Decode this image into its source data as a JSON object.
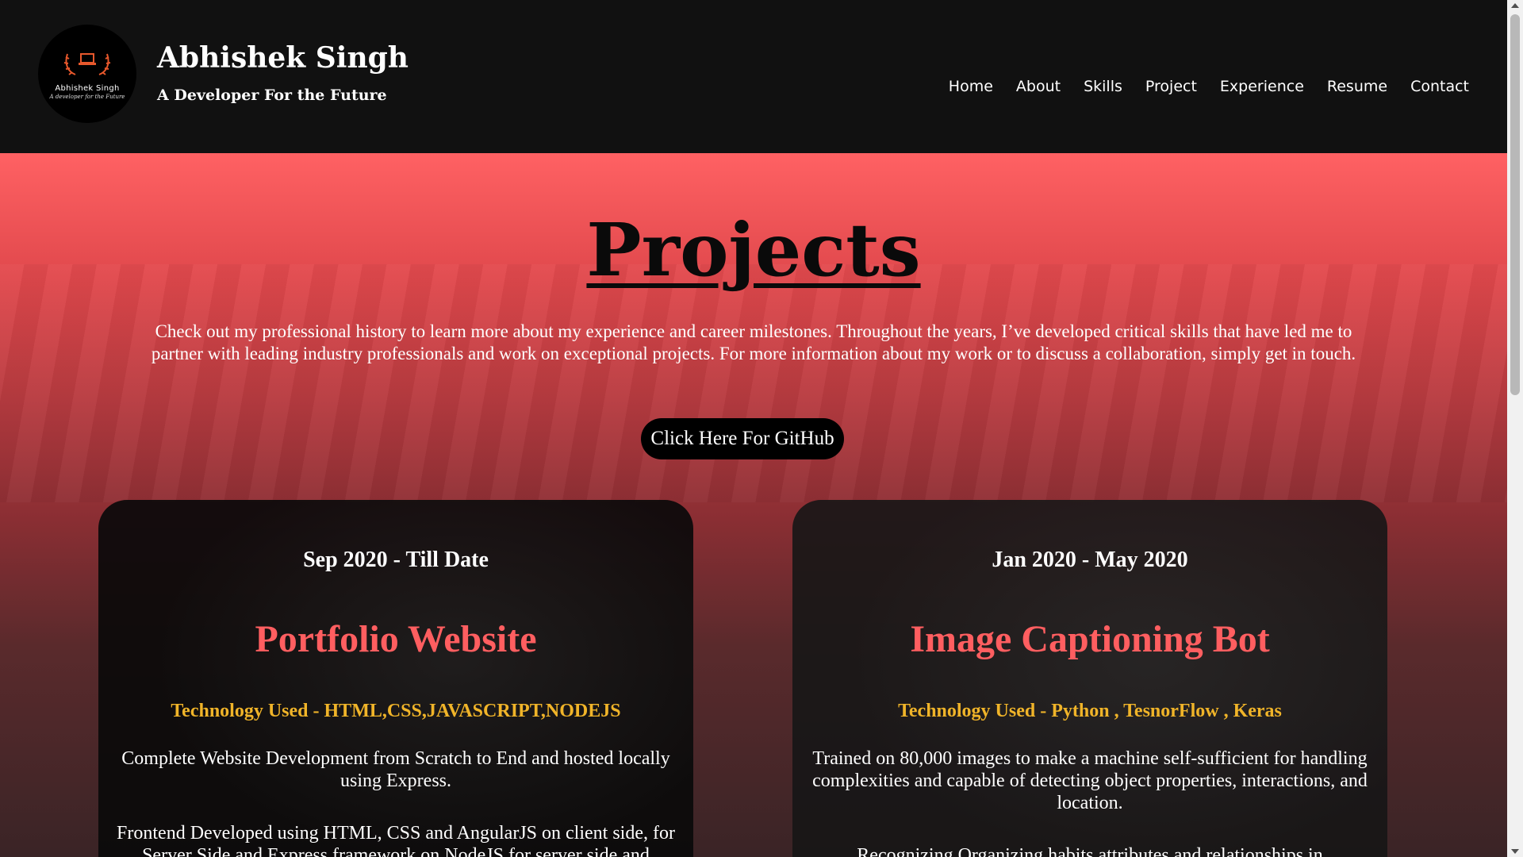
{
  "brand": {
    "logo_name": "Abhishek Singh",
    "logo_tagline": "A developer for the Future",
    "title": "Abhishek Singh",
    "subtitle": "A Developer For the Future"
  },
  "nav": [
    "Home",
    "About",
    "Skills",
    "Project",
    "Experience",
    "Resume",
    "Contact"
  ],
  "projects_section": {
    "title": "Projects",
    "intro": "Check out my professional history to learn more about my experience and career milestones. Throughout the years, I’ve developed critical skills that have led me to partner with leading industry professionals and work on exceptional projects. For more information about my work or to discuss a collaboration, simply get in touch.",
    "github_button": "Click Here For GitHub"
  },
  "projects": [
    {
      "dates": "Sep 2020 - Till Date",
      "title": "Portfolio Website",
      "tech": "Technology Used - HTML,CSS,JAVASCRIPT,NODEJS",
      "desc": "Complete Website Development from Scratch to End and hosted locally using Express.",
      "desc2": "Frontend Developed using HTML, CSS and AngularJS on client side, for Server Side and Express framework on NodeJS for server side and"
    },
    {
      "dates": "Jan 2020 - May 2020",
      "title": "Image Captioning Bot",
      "tech": "Technology Used - Python , TesnorFlow , Keras",
      "desc": "Trained on 80,000 images to make a machine self-sufficient for handling complexities and capable of detecting object properties, interactions, and location.",
      "desc2": "Recognizing Organizing habits attributes and relationships in"
    }
  ],
  "colors": {
    "header_bg": "#111111",
    "accent_red": "#ff5e60",
    "tech_yellow": "#f0b429"
  }
}
